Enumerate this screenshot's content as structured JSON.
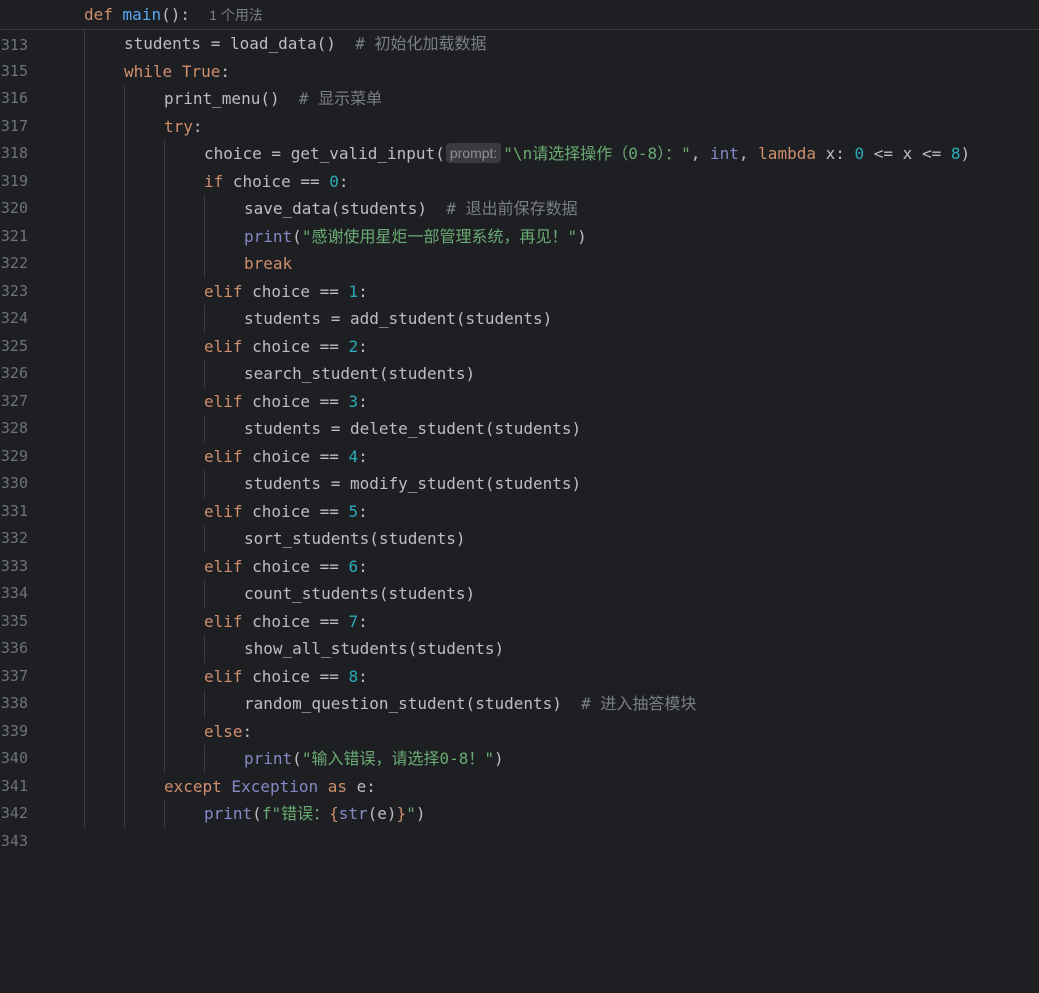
{
  "editor": {
    "usages_hint": "1 个用法",
    "param_hint": "prompt:",
    "lines": [
      {
        "no": "313"
      },
      {
        "no": "315"
      },
      {
        "no": "316"
      },
      {
        "no": "317"
      },
      {
        "no": "318"
      },
      {
        "no": "319"
      },
      {
        "no": "320"
      },
      {
        "no": "321"
      },
      {
        "no": "322"
      },
      {
        "no": "323"
      },
      {
        "no": "324"
      },
      {
        "no": "325"
      },
      {
        "no": "326"
      },
      {
        "no": "327"
      },
      {
        "no": "328"
      },
      {
        "no": "329"
      },
      {
        "no": "330"
      },
      {
        "no": "331"
      },
      {
        "no": "332"
      },
      {
        "no": "333"
      },
      {
        "no": "334"
      },
      {
        "no": "335"
      },
      {
        "no": "336"
      },
      {
        "no": "337"
      },
      {
        "no": "338"
      },
      {
        "no": "339"
      },
      {
        "no": "340"
      },
      {
        "no": "341"
      },
      {
        "no": "342"
      },
      {
        "no": "343"
      }
    ],
    "code": {
      "l313": {
        "def": "def",
        "name": "main",
        "rest": "():"
      },
      "l315": {
        "a": "students = load_data()  ",
        "c": "# 初始化加载数据"
      },
      "l316": {
        "kw": "while",
        "t": "True",
        "rest": ":"
      },
      "l317": {
        "a": "print_menu()  ",
        "c": "# 显示菜单"
      },
      "l318": {
        "kw": "try",
        "rest": ":"
      },
      "l319": {
        "a": "choice = get_valid_input(",
        "s": "\"\\n请选择操作（0-8）：\"",
        "b": ", ",
        "int": "int",
        "c2": ", ",
        "lambda": "lambda",
        "d": " x: ",
        "n0": "0",
        "e": " <= x <= ",
        "n8": "8",
        "f": ")"
      },
      "l320": {
        "kw": "if",
        "a": " choice == ",
        "n": "0",
        "rest": ":"
      },
      "l321": {
        "a": "save_data(students)  ",
        "c": "# 退出前保存数据"
      },
      "l322": {
        "fn": "print",
        "p1": "(",
        "s": "\"感谢使用星炬一部管理系统，再见！\"",
        "p2": ")"
      },
      "l323": {
        "kw": "break"
      },
      "l324": {
        "kw": "elif",
        "a": " choice == ",
        "n": "1",
        "rest": ":"
      },
      "l325": {
        "a": "students = add_student(students)"
      },
      "l326": {
        "kw": "elif",
        "a": " choice == ",
        "n": "2",
        "rest": ":"
      },
      "l327": {
        "a": "search_student(students)"
      },
      "l328": {
        "kw": "elif",
        "a": " choice == ",
        "n": "3",
        "rest": ":"
      },
      "l329": {
        "a": "students = delete_student(students)"
      },
      "l330": {
        "kw": "elif",
        "a": " choice == ",
        "n": "4",
        "rest": ":"
      },
      "l331": {
        "a": "students = modify_student(students)"
      },
      "l332": {
        "kw": "elif",
        "a": " choice == ",
        "n": "5",
        "rest": ":"
      },
      "l333": {
        "a": "sort_students(students)"
      },
      "l334": {
        "kw": "elif",
        "a": " choice == ",
        "n": "6",
        "rest": ":"
      },
      "l335": {
        "a": "count_students(students)"
      },
      "l336": {
        "kw": "elif",
        "a": " choice == ",
        "n": "7",
        "rest": ":"
      },
      "l337": {
        "a": "show_all_students(students)"
      },
      "l338": {
        "kw": "elif",
        "a": " choice == ",
        "n": "8",
        "rest": ":"
      },
      "l339": {
        "a": "random_question_student(students)  ",
        "c": "# 进入抽答模块"
      },
      "l340": {
        "kw": "else",
        "rest": ":"
      },
      "l341": {
        "fn": "print",
        "p1": "(",
        "s": "\"输入错误，请选择0-8！\"",
        "p2": ")"
      },
      "l342": {
        "kw": "except",
        "cls": " Exception ",
        "as": "as",
        "rest": " e:"
      },
      "l343": {
        "fn": "print",
        "p1": "(",
        "f": "f\"错误：",
        "b1": "{",
        "str": "str",
        "inner": "(e)",
        "b2": "}",
        "q": "\"",
        "p2": ")"
      }
    }
  },
  "colors": {
    "background": "#1e1f22",
    "keyword": "#cf8e6d",
    "function": "#56a8f5",
    "builtin": "#8888c6",
    "number": "#2aacb8",
    "string": "#6aab73",
    "comment": "#7a7e85",
    "text": "#bcbec4",
    "line_number": "#6f737a"
  }
}
